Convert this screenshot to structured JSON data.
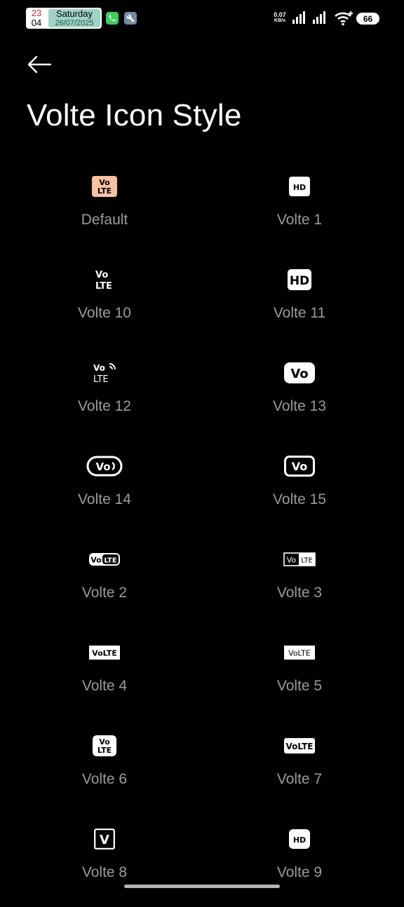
{
  "status": {
    "clock_hours": "23",
    "clock_minutes": "04",
    "weekday": "Saturday",
    "date": "26/07/2025",
    "net_speed_value": "0.07",
    "net_speed_unit": "KB/s",
    "battery": "66"
  },
  "header": {
    "title": "Volte Icon Style"
  },
  "options": [
    {
      "label": "Default",
      "icon": "volte-default-icon"
    },
    {
      "label": "Volte 1",
      "icon": "hd-small-icon"
    },
    {
      "label": "Volte 10",
      "icon": "vo-lte-text-icon"
    },
    {
      "label": "Volte 11",
      "icon": "hd-large-icon"
    },
    {
      "label": "Volte 12",
      "icon": "vo-lte-wave-icon"
    },
    {
      "label": "Volte 13",
      "icon": "vo-filled-icon"
    },
    {
      "label": "Volte 14",
      "icon": "vo-oval-icon"
    },
    {
      "label": "Volte 15",
      "icon": "vo-outline-icon"
    },
    {
      "label": "Volte 2",
      "icon": "volte-split-pill-icon"
    },
    {
      "label": "Volte 3",
      "icon": "volte-split-box-icon"
    },
    {
      "label": "Volte 4",
      "icon": "volte-filled-box-icon"
    },
    {
      "label": "Volte 5",
      "icon": "volte-wave-box-icon"
    },
    {
      "label": "Volte 6",
      "icon": "vo-lte-rounded-icon"
    },
    {
      "label": "Volte 7",
      "icon": "volte-bold-icon"
    },
    {
      "label": "Volte 8",
      "icon": "v-outline-icon"
    },
    {
      "label": "Volte 9",
      "icon": "hd-rounded-icon"
    }
  ],
  "icon_text": {
    "vo": "Vo",
    "lte": "LTE",
    "volte": "VoLTE",
    "hd": "HD",
    "v": "V"
  },
  "colors": {
    "background": "#000000",
    "label": "#9b9b9b",
    "default_icon": "#f6c2a3",
    "clock_accent": "#d0262a",
    "date_bg": "#9ed3c6"
  }
}
